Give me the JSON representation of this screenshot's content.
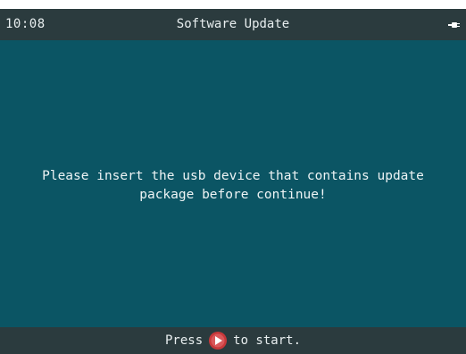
{
  "status_bar": {
    "time": "10:08",
    "title": "Software Update",
    "battery_icon": "battery-charging-icon"
  },
  "message": {
    "line1": "Please insert the usb device that contains update",
    "line2": "package before continue!"
  },
  "bottom_bar": {
    "prefix": "Press",
    "icon": "play-button-icon",
    "suffix": "to start."
  },
  "colors": {
    "screen_background": "#0b5564",
    "bar_background": "#2b3b3e",
    "text": "#eef4f5",
    "play_button": "#c8383a"
  }
}
